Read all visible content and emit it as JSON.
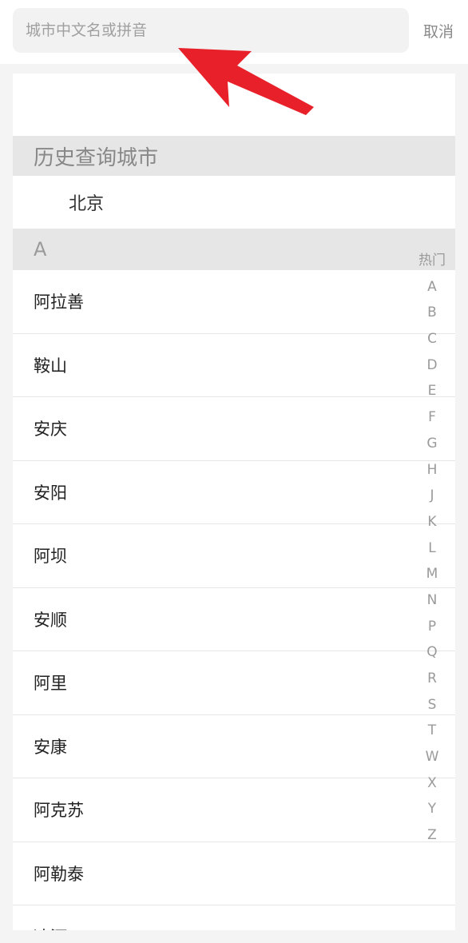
{
  "search": {
    "placeholder": "城市中文名或拼音",
    "cancel_label": "取消"
  },
  "history": {
    "title": "历史查询城市",
    "cities": [
      "北京"
    ]
  },
  "section": {
    "letter": "A"
  },
  "cities": [
    "阿拉善",
    "鞍山",
    "安庆",
    "安阳",
    "阿坝",
    "安顺",
    "阿里",
    "安康",
    "阿克苏",
    "阿勒泰",
    "凌河"
  ],
  "index_bar": [
    "热门",
    "A",
    "B",
    "C",
    "D",
    "E",
    "F",
    "G",
    "H",
    "J",
    "K",
    "L",
    "M",
    "N",
    "P",
    "Q",
    "R",
    "S",
    "T",
    "W",
    "X",
    "Y",
    "Z"
  ],
  "colors": {
    "arrow": "#e8202a",
    "section_bg": "#e6e6e6",
    "index_text": "#9a9a9a"
  }
}
